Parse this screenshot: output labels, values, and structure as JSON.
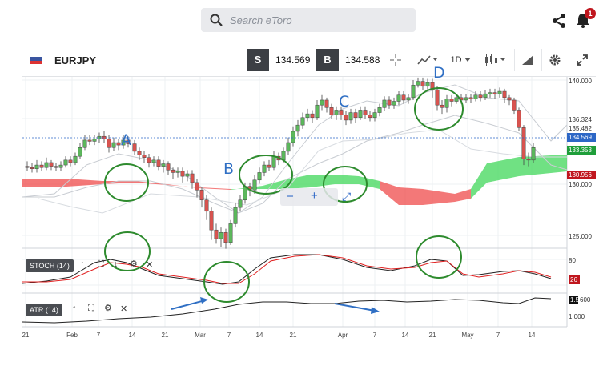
{
  "header": {
    "search_placeholder": "Search eToro",
    "notification_count": "1"
  },
  "instrument": {
    "symbol": "EURJPY",
    "sell_label": "S",
    "sell_price": "134.569",
    "buy_label": "B",
    "buy_price": "134.588",
    "timeframe": "1D"
  },
  "price_axis": {
    "ticks": [
      "140.000",
      "136.324",
      "135.482",
      "130.000",
      "125.000"
    ],
    "current_price": "134.569",
    "tag_green": "133.353",
    "tag_red": "130.956"
  },
  "stoch": {
    "label": "STOCH (14)",
    "tick_80": "80",
    "tag": "26"
  },
  "atr": {
    "label": "ATR (14)",
    "tag": "1.5",
    "tick_600": "600",
    "tick_1000": "1.000"
  },
  "zoom": {
    "minus": "−",
    "plus": "+"
  },
  "x_axis": {
    "labels": [
      "21",
      "Feb",
      "7",
      "14",
      "21",
      "Mar",
      "7",
      "14",
      "21",
      "Apr",
      "7",
      "14",
      "21",
      "May",
      "7",
      "14"
    ]
  },
  "annotations": {
    "a": "A",
    "b": "B",
    "c": "C",
    "d": "D"
  },
  "colors": {
    "bull": "#5cb85c",
    "bear": "#d9534f",
    "cloud_green": "#4cd964",
    "cloud_red": "#ef4b4b",
    "annotation": "#2f6fc4",
    "circle": "#2e8b2e"
  }
}
